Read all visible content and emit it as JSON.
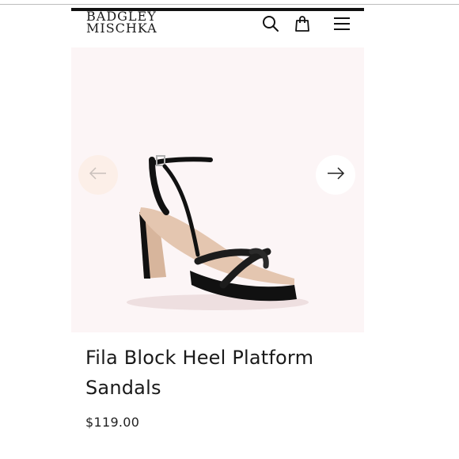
{
  "brand": {
    "line1": "BADGLEY",
    "line2": "MISCHKA"
  },
  "header": {
    "icons": [
      "search-icon",
      "shopping-bag-icon",
      "hamburger-menu-icon"
    ]
  },
  "gallery": {
    "background": "#fcf5f6",
    "prev_icon": "arrow-left-icon",
    "next_icon": "arrow-right-icon"
  },
  "product": {
    "title": "Fila Block Heel Platform Sandals",
    "price": "$119.00"
  }
}
